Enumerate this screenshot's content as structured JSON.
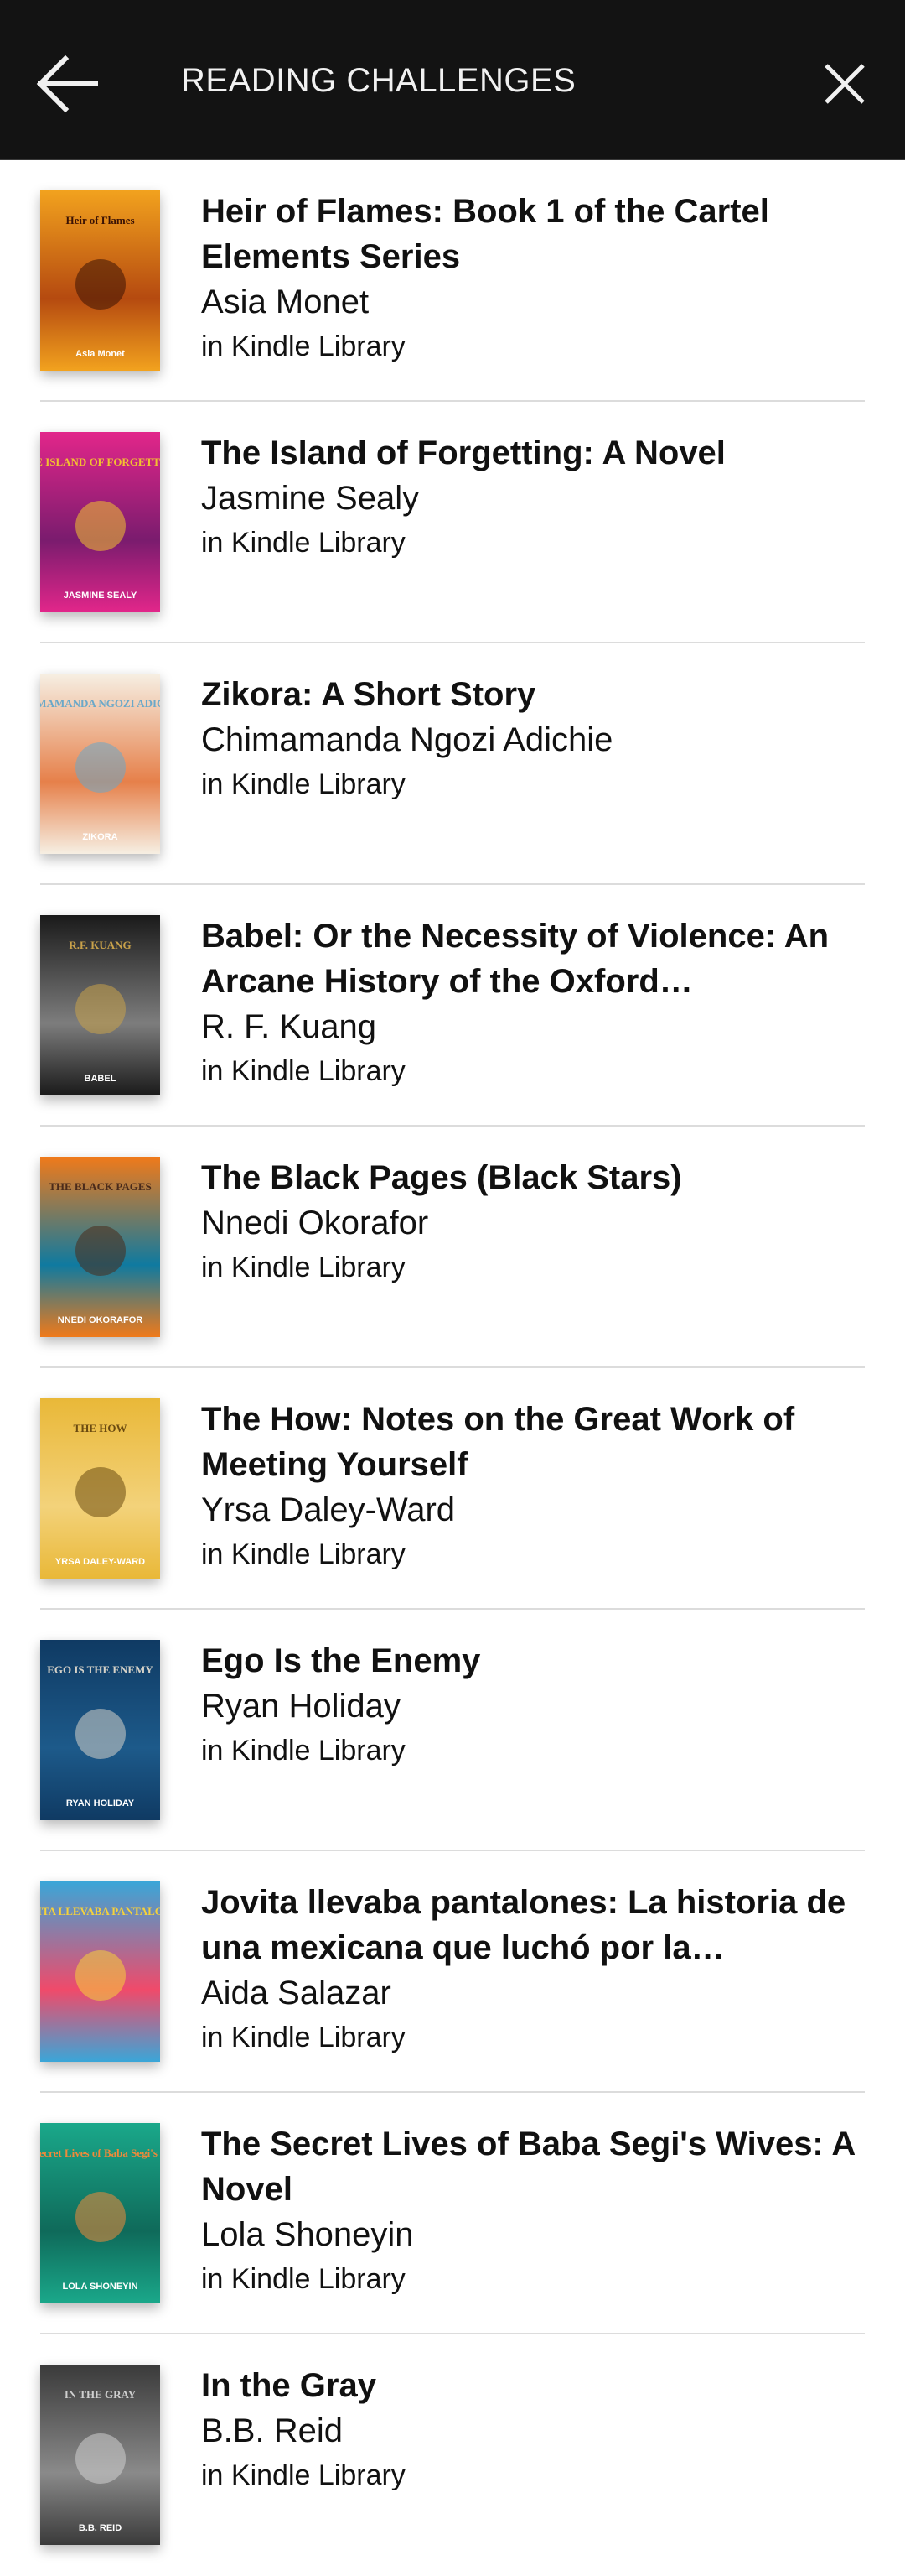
{
  "header": {
    "title": "READING CHALLENGES",
    "back_icon": "arrow-left-icon",
    "close_icon": "close-icon"
  },
  "books": [
    {
      "title": "Heir of Flames: Book 1 of the Cartel Elements Series",
      "author": "Asia Monet",
      "location": "in Kindle Library",
      "cover": {
        "line1": "Heir of Flames",
        "line2": "Asia Monet",
        "colors": [
          "#f2a21e",
          "#b54a10",
          "#3a1204"
        ]
      }
    },
    {
      "title": "The Island of Forgetting: A Novel",
      "author": "Jasmine Sealy",
      "location": "in Kindle Library",
      "cover": {
        "line1": "THE ISLAND OF FORGETTING",
        "line2": "JASMINE SEALY",
        "colors": [
          "#e2268a",
          "#7a1c6e",
          "#f2c230"
        ]
      }
    },
    {
      "title": "Zikora: A Short Story",
      "author": "Chimamanda Ngozi Adichie",
      "location": "in Kindle Library",
      "cover": {
        "line1": "CHIMAMANDA NGOZI ADICHIE",
        "line2": "ZIKORA",
        "colors": [
          "#f6efe3",
          "#e6804a",
          "#6aa8c9"
        ]
      }
    },
    {
      "title": "Babel: Or the Necessity of Violence: An Arcane History of the Oxford…",
      "author": "R. F. Kuang",
      "location": "in Kindle Library",
      "cover": {
        "line1": "R.F. KUANG",
        "line2": "BABEL",
        "colors": [
          "#1a1a1a",
          "#7d7d7d",
          "#c9a24a"
        ]
      }
    },
    {
      "title": "The Black Pages (Black Stars)",
      "author": "Nnedi Okorafor",
      "location": "in Kindle Library",
      "cover": {
        "line1": "THE BLACK PAGES",
        "line2": "NNEDI OKORAFOR",
        "colors": [
          "#f07a1a",
          "#0f7aa0",
          "#4a2a1a"
        ]
      }
    },
    {
      "title": "The How: Notes on the Great Work of Meeting Yourself",
      "author": "Yrsa Daley-Ward",
      "location": "in Kindle Library",
      "cover": {
        "line1": "THE HOW",
        "line2": "YRSA DALEY-WARD",
        "colors": [
          "#e9b838",
          "#f3d27a",
          "#6a4a10"
        ]
      }
    },
    {
      "title": "Ego Is the Enemy",
      "author": "Ryan Holiday",
      "location": "in Kindle Library",
      "cover": {
        "line1": "EGO IS THE ENEMY",
        "line2": "RYAN HOLIDAY",
        "colors": [
          "#0f3a63",
          "#1d5a8a",
          "#d6d2c8"
        ]
      }
    },
    {
      "title": "Jovita llevaba pantalones: La historia de una mexicana que luchó por la…",
      "author": "Aida Salazar",
      "location": "in Kindle Library",
      "cover": {
        "line1": "JOVITA LLEVABA PANTALONES",
        "line2": "",
        "colors": [
          "#3aa6d8",
          "#f04a6a",
          "#f6d23a"
        ]
      }
    },
    {
      "title": "The Secret Lives of Baba Segi's Wives: A Novel",
      "author": "Lola Shoneyin",
      "location": "in Kindle Library",
      "cover": {
        "line1": "The Secret Lives of Baba Segi's Wives",
        "line2": "LOLA SHONEYIN",
        "colors": [
          "#1aa88a",
          "#0f6a5a",
          "#f08a3a"
        ]
      }
    },
    {
      "title": "In the Gray",
      "author": "B.B. Reid",
      "location": "in Kindle Library",
      "cover": {
        "line1": "IN THE GRAY",
        "line2": "B.B. REID",
        "colors": [
          "#3a3a3a",
          "#8a8a8a",
          "#cfcfcf"
        ]
      }
    }
  ]
}
